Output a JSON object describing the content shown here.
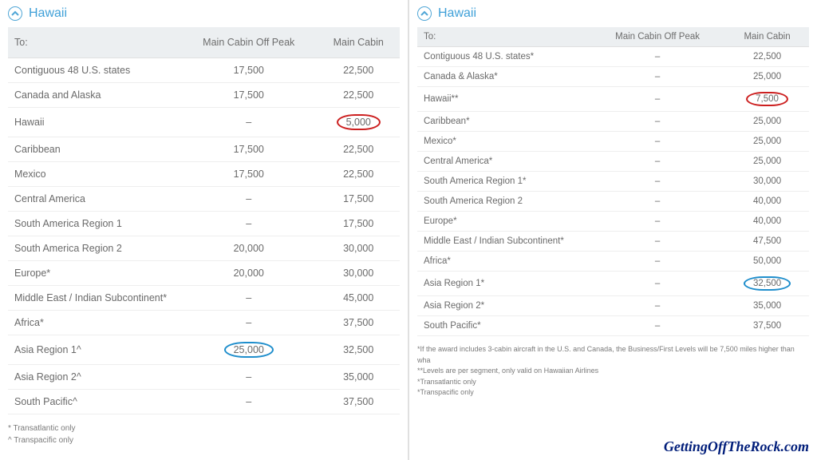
{
  "section_title": "Hawaii",
  "columns": {
    "to": "To:",
    "offpeak": "Main Cabin Off Peak",
    "main": "Main Cabin"
  },
  "left": {
    "rows": [
      {
        "dest": "Contiguous 48 U.S. states",
        "offpeak": "17,500",
        "main": "22,500"
      },
      {
        "dest": "Canada and Alaska",
        "offpeak": "17,500",
        "main": "22,500"
      },
      {
        "dest": "Hawaii",
        "offpeak": "–",
        "main": "5,000",
        "circle_main": "red"
      },
      {
        "dest": "Caribbean",
        "offpeak": "17,500",
        "main": "22,500"
      },
      {
        "dest": "Mexico",
        "offpeak": "17,500",
        "main": "22,500"
      },
      {
        "dest": "Central America",
        "offpeak": "–",
        "main": "17,500"
      },
      {
        "dest": "South America Region 1",
        "offpeak": "–",
        "main": "17,500"
      },
      {
        "dest": "South America Region 2",
        "offpeak": "20,000",
        "main": "30,000"
      },
      {
        "dest": "Europe*",
        "offpeak": "20,000",
        "main": "30,000"
      },
      {
        "dest": "Middle East / Indian Subcontinent*",
        "offpeak": "–",
        "main": "45,000"
      },
      {
        "dest": "Africa*",
        "offpeak": "–",
        "main": "37,500"
      },
      {
        "dest": "Asia Region 1^",
        "offpeak": "25,000",
        "main": "32,500",
        "circle_offpeak": "blue"
      },
      {
        "dest": "Asia Region 2^",
        "offpeak": "–",
        "main": "35,000"
      },
      {
        "dest": "South Pacific^",
        "offpeak": "–",
        "main": "37,500"
      }
    ],
    "footnotes": [
      "* Transatlantic only",
      "^ Transpacific only"
    ]
  },
  "right": {
    "rows": [
      {
        "dest": "Contiguous 48 U.S. states*",
        "offpeak": "–",
        "main": "22,500"
      },
      {
        "dest": "Canada & Alaska*",
        "offpeak": "–",
        "main": "25,000"
      },
      {
        "dest": "Hawaii**",
        "offpeak": "–",
        "main": "7,500",
        "circle_main": "red"
      },
      {
        "dest": "Caribbean*",
        "offpeak": "–",
        "main": "25,000"
      },
      {
        "dest": "Mexico*",
        "offpeak": "–",
        "main": "25,000"
      },
      {
        "dest": "Central America*",
        "offpeak": "–",
        "main": "25,000"
      },
      {
        "dest": "South America Region 1*",
        "offpeak": "–",
        "main": "30,000"
      },
      {
        "dest": "South America Region 2",
        "offpeak": "–",
        "main": "40,000"
      },
      {
        "dest": "Europe*",
        "offpeak": "–",
        "main": "40,000"
      },
      {
        "dest": "Middle East / Indian Subcontinent*",
        "offpeak": "–",
        "main": "47,500"
      },
      {
        "dest": "Africa*",
        "offpeak": "–",
        "main": "50,000"
      },
      {
        "dest": "Asia Region 1*",
        "offpeak": "–",
        "main": "32,500",
        "circle_main": "blue"
      },
      {
        "dest": "Asia Region 2*",
        "offpeak": "–",
        "main": "35,000"
      },
      {
        "dest": "South Pacific*",
        "offpeak": "–",
        "main": "37,500"
      }
    ],
    "footnotes": [
      "*If the award includes 3-cabin aircraft in the U.S. and Canada, the Business/First Levels will be 7,500 miles higher than wha",
      "**Levels are per segment, only valid on Hawaiian Airlines",
      "*Transatlantic only",
      "*Transpacific only"
    ]
  },
  "watermark": "GettingOffTheRock.com"
}
